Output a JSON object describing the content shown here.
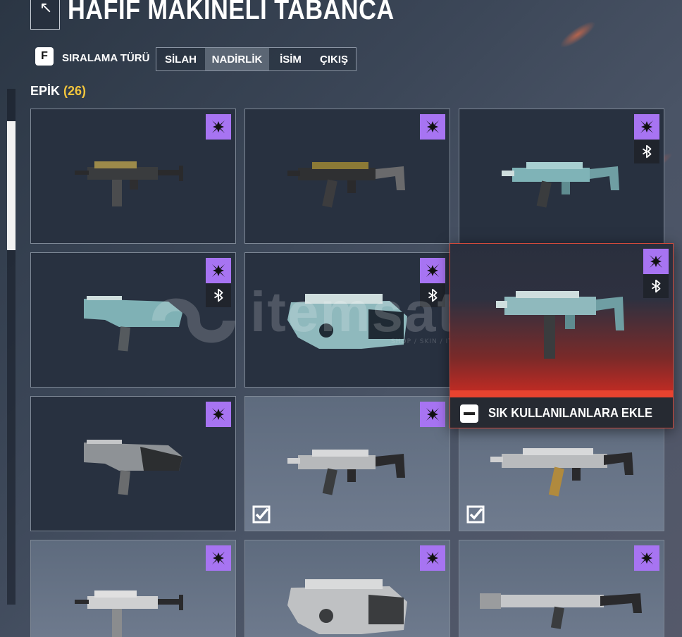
{
  "header": {
    "back_icon": "back-arrow-icon",
    "title": "HAFİF MAKİNELİ TABANCA"
  },
  "sort": {
    "key_hint": "F",
    "label": "SIRALAMA TÜRÜ",
    "options": [
      "SİLAH",
      "NADİRLİK",
      "İSİM",
      "ÇIKIŞ"
    ],
    "active": "NADİRLİK"
  },
  "section": {
    "title": "EPİK",
    "count": "(26)"
  },
  "colors": {
    "rarity_epic": "#a774f2",
    "count_accent": "#f2c53d",
    "highlight_red": "#d63a2c"
  },
  "cards": [
    {
      "gun": "smg-compact-gold",
      "badge_icon": "epic-x-icon",
      "extra_icon": "",
      "equipped": false
    },
    {
      "gun": "smg-mp5k-gold",
      "badge_icon": "epic-x-icon",
      "extra_icon": "",
      "equipped": false
    },
    {
      "gun": "smg-mp5k-teal",
      "badge_icon": "epic-x-icon",
      "extra_icon": "variant-icon",
      "equipped": false
    },
    {
      "gun": "smg-fmg-teal",
      "badge_icon": "epic-x-icon",
      "extra_icon": "variant-icon",
      "equipped": false
    },
    {
      "gun": "smg-p90-teal",
      "badge_icon": "epic-x-icon",
      "extra_icon": "variant-icon",
      "equipped": false
    },
    {
      "gun": "smg-ump-teal",
      "badge_icon": "epic-x-icon",
      "extra_icon": "variant-icon",
      "equipped": false
    },
    {
      "gun": "smg-fmg-camo",
      "badge_icon": "epic-x-icon",
      "extra_icon": "",
      "equipped": false
    },
    {
      "gun": "smg-mp5k-camo",
      "badge_icon": "epic-x-icon",
      "extra_icon": "",
      "equipped": true
    },
    {
      "gun": "smg-mp5-camo",
      "badge_icon": "epic-x-icon",
      "extra_icon": "",
      "equipped": true
    },
    {
      "gun": "smg-mp7-camo",
      "badge_icon": "epic-x-icon",
      "extra_icon": "",
      "equipped": false
    },
    {
      "gun": "smg-p90-camo",
      "badge_icon": "epic-x-icon",
      "extra_icon": "",
      "equipped": false
    },
    {
      "gun": "smg-sterling-camo",
      "badge_icon": "epic-x-icon",
      "extra_icon": "",
      "equipped": false
    }
  ],
  "popup": {
    "action_label": "SIK KULLANILANLARA EKLE",
    "action_icon": "minus-key-icon"
  },
  "watermark": {
    "text": "itemsatış",
    "sub": "SHOP / SKIN / ITEM / E-PIN",
    "domain": ".com"
  }
}
